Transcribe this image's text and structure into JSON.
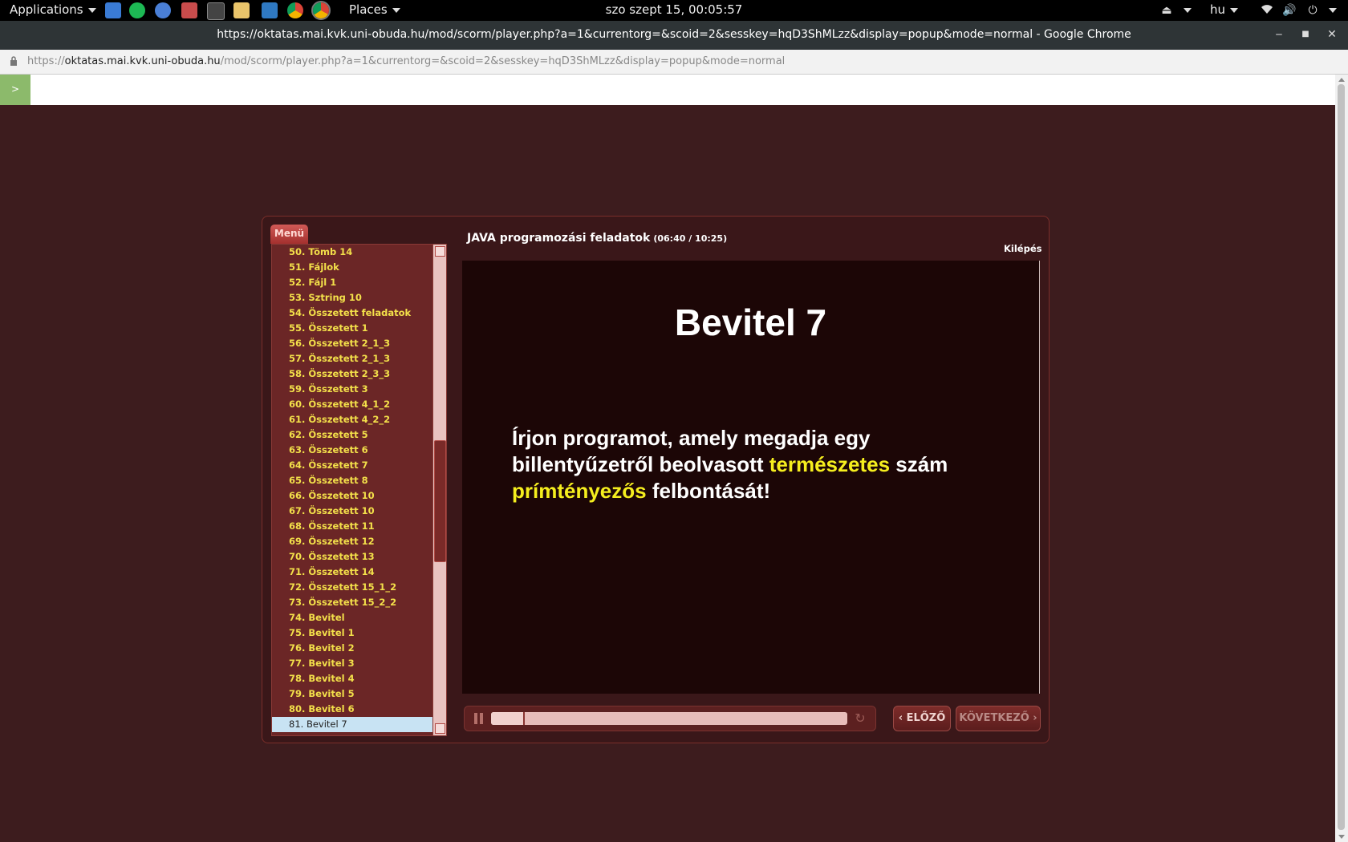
{
  "topbar": {
    "applications": "Applications",
    "places": "Places",
    "clock": "szo szept 15, 00:05:57",
    "language": "hu"
  },
  "window": {
    "title": "https://oktatas.mai.kvk.uni-obuda.hu/mod/scorm/player.php?a=1&currentorg=&scoid=2&sesskey=hqD3ShMLzz&display=popup&mode=normal - Google Chrome"
  },
  "address_bar": {
    "scheme": "https://",
    "host": "oktatas.mai.kvk.uni-obuda.hu",
    "path": "/mod/scorm/player.php?a=1&currentorg=&scoid=2&sesskey=hqD3ShMLzz&display=popup&mode=normal"
  },
  "toc_toggle": ">",
  "player": {
    "menu_tab": "Menü",
    "course_title": "JAVA programozási feladatok",
    "time": "(06:40 / 10:25)",
    "exit": "Kilépés",
    "menu_items": [
      "50. Tömb 14",
      "51. Fájlok",
      "52. Fájl 1",
      "53. Sztring 10",
      "54. Összetett  feladatok",
      "55. Összetett 1",
      "56. Összetett 2_1_3",
      "57. Összetett 2_1_3",
      "58. Összetett 2_3_3",
      "59. Összetett 3",
      "60. Összetett 4_1_2",
      "61. Összetett 4_2_2",
      "62. Összetett 5",
      "63. Összetett 6",
      "64. Összetett 7",
      "65. Összetett 8",
      "66. Összetett 10",
      "67. Összetett 10",
      "68. Összetett 11",
      "69. Összetett 12",
      "70. Összetett 13",
      "71. Összetett 14",
      "72. Összetett 15_1_2",
      "73. Összetett 15_2_2",
      "74. Bevitel",
      "75. Bevitel 1",
      "76. Bevitel 2",
      "77. Bevitel 3",
      "78. Bevitel 4",
      "79. Bevitel 5",
      "80. Bevitel 6",
      "81. Bevitel 7"
    ],
    "active_index": 31,
    "slide": {
      "title": "Bevitel 7",
      "body_1": "Írjon programot, amely megadja egy billentyűzetről beolvasott ",
      "body_hl1": "természetes",
      "body_2": " szám ",
      "body_hl2": "prímtényezős",
      "body_3": " felbontását!"
    },
    "progress": 0.09,
    "prev_label": "ELŐZŐ",
    "next_label": "KÖVETKEZŐ"
  }
}
